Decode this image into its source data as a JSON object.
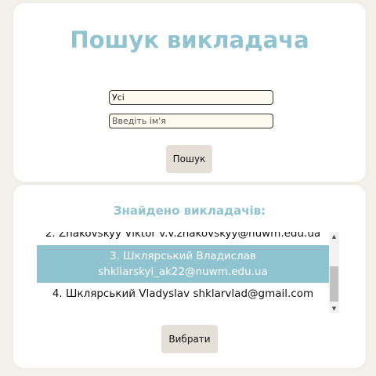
{
  "search": {
    "title": "Пошук викладача",
    "department_selected": "Усі",
    "name_placeholder": "Введіть ім'я",
    "search_button": "Пошук"
  },
  "results": {
    "title": "Знайдено викладачів:",
    "items": [
      {
        "label": "2. Znakovskyy Viktor v.v.znakovskyy@nuwm.edu.ua"
      },
      {
        "label": "3. Шклярський Владислав shkliarskyi_ak22@nuwm.edu.ua",
        "line1": "3. Шклярський Владислав",
        "line2": "shkliarskyi_ak22@nuwm.edu.ua",
        "selected": true
      },
      {
        "label": "4. Шклярський Vladyslav shklarvlad@gmail.com"
      }
    ],
    "choose_button": "Вибрати"
  },
  "colors": {
    "accent": "#8fc3cf",
    "background": "#f4f1ea",
    "button": "#e6dfd8",
    "input_bg": "#fdfaf0"
  }
}
